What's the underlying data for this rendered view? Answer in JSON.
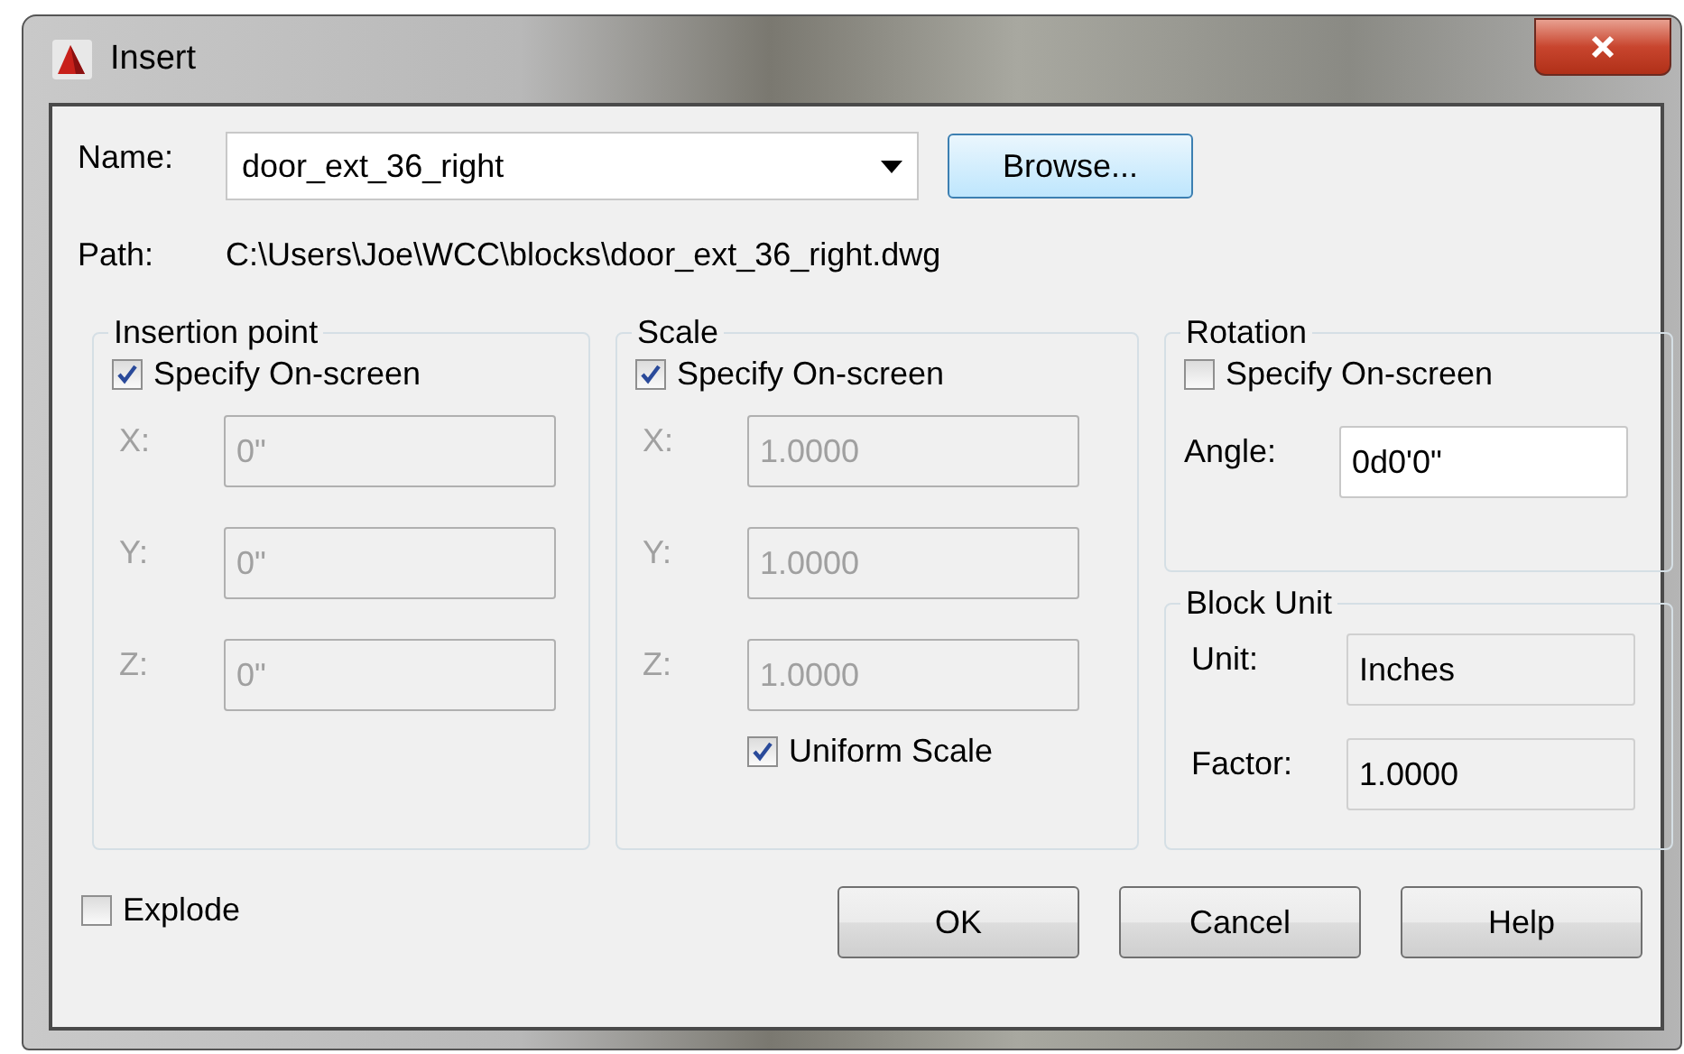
{
  "window": {
    "title": "Insert"
  },
  "name": {
    "label": "Name:",
    "value": "door_ext_36_right"
  },
  "browse_button": "Browse...",
  "path": {
    "label": "Path:",
    "value": "C:\\Users\\Joe\\WCC\\blocks\\door_ext_36_right.dwg"
  },
  "insertion_point": {
    "title": "Insertion point",
    "specify_on_screen": {
      "label": "Specify On-screen",
      "checked": true
    },
    "fields": [
      {
        "label": "X:",
        "value": "0\"",
        "disabled": true
      },
      {
        "label": "Y:",
        "value": "0\"",
        "disabled": true
      },
      {
        "label": "Z:",
        "value": "0\"",
        "disabled": true
      }
    ]
  },
  "scale": {
    "title": "Scale",
    "specify_on_screen": {
      "label": "Specify On-screen",
      "checked": true
    },
    "fields": [
      {
        "label": "X:",
        "value": "1.0000",
        "disabled": true
      },
      {
        "label": "Y:",
        "value": "1.0000",
        "disabled": true
      },
      {
        "label": "Z:",
        "value": "1.0000",
        "disabled": true
      }
    ],
    "uniform_scale": {
      "label": "Uniform Scale",
      "checked": true
    }
  },
  "rotation": {
    "title": "Rotation",
    "specify_on_screen": {
      "label": "Specify On-screen",
      "checked": false
    },
    "angle": {
      "label": "Angle:",
      "value": "0d0'0\"",
      "disabled": false
    }
  },
  "block_unit": {
    "title": "Block Unit",
    "fields": [
      {
        "label": "Unit:",
        "value": "Inches",
        "readonly": true
      },
      {
        "label": "Factor:",
        "value": "1.0000",
        "readonly": true
      }
    ]
  },
  "explode": {
    "label": "Explode",
    "checked": false
  },
  "buttons": [
    "OK",
    "Cancel",
    "Help"
  ]
}
